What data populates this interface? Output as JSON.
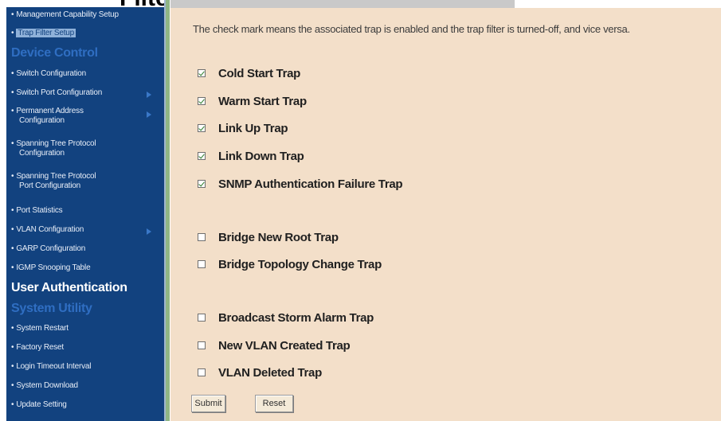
{
  "page_title": "Filter Setup",
  "sidebar": {
    "items": [
      {
        "label": "Management Capability Setup",
        "selected": false
      },
      {
        "label": "Trap Filter Setup",
        "selected": true
      }
    ],
    "section_device_control": "Device Control",
    "device_items": [
      {
        "line1": "Switch Configuration",
        "line2": ""
      },
      {
        "line1": "Switch Port Configuration",
        "line2": ""
      },
      {
        "line1": "Permanent Address",
        "line2": "Configuration"
      },
      {
        "line1": "Spanning Tree Protocol",
        "line2": "Configuration"
      },
      {
        "line1": "Spanning Tree Protocol",
        "line2": "Port Configuration"
      },
      {
        "line1": "Port Statistics",
        "line2": ""
      },
      {
        "line1": "VLAN Configuration",
        "line2": ""
      },
      {
        "line1": "GARP Configuration",
        "line2": ""
      },
      {
        "line1": "IGMP Snooping Table",
        "line2": ""
      }
    ],
    "section_user_auth": "User Authentication",
    "section_system_utility": "System Utility",
    "utility_items": [
      {
        "label": "System Restart"
      },
      {
        "label": "Factory Reset"
      },
      {
        "label": "Login Timeout Interval"
      },
      {
        "label": "System Download"
      },
      {
        "label": "Update Setting"
      }
    ],
    "bullet": "•"
  },
  "main": {
    "description": "The check mark means the associated trap is enabled and the trap filter is turned-off, and vice versa.",
    "traps": [
      {
        "label": "Cold Start Trap",
        "checked": true
      },
      {
        "label": "Warm Start Trap",
        "checked": true
      },
      {
        "label": "Link Up Trap",
        "checked": true
      },
      {
        "label": "Link Down Trap",
        "checked": true
      },
      {
        "label": "SNMP Authentication Failure Trap",
        "checked": true
      },
      {
        "label": "Bridge New Root Trap",
        "checked": false
      },
      {
        "label": "Bridge Topology Change Trap",
        "checked": false
      },
      {
        "label": "Broadcast Storm Alarm Trap",
        "checked": false
      },
      {
        "label": "New VLAN Created Trap",
        "checked": false
      },
      {
        "label": "VLAN Deleted Trap",
        "checked": false
      }
    ],
    "submit_label": "Submit",
    "reset_label": "Reset"
  },
  "colors": {
    "sidebar_bg": "#12427f",
    "content_bg": "#f3dfc9",
    "separator": "#8fb685"
  }
}
